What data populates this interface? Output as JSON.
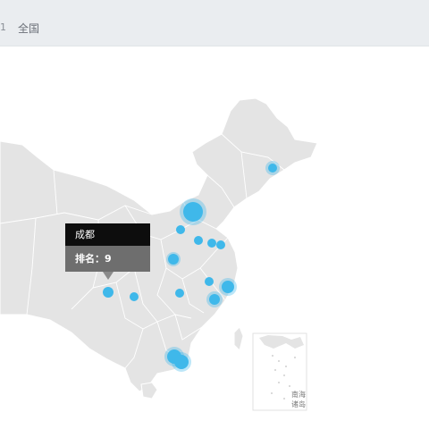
{
  "breadcrumb": {
    "prev": "1",
    "current": "全国"
  },
  "map": {
    "land_color": "#e4e4e4",
    "border_color": "#ffffff",
    "marker_color": "#3fb8ea",
    "inset_label_line1": "南海",
    "inset_label_line2": "诸岛"
  },
  "tooltip": {
    "city": "成都",
    "rank_label": "排名：",
    "rank_value": "9"
  }
}
